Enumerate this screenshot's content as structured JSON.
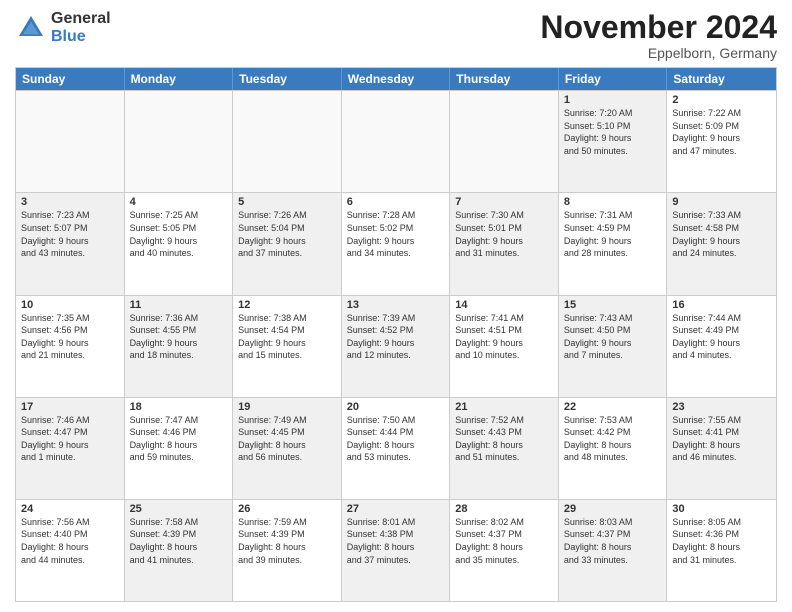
{
  "header": {
    "logo_general": "General",
    "logo_blue": "Blue",
    "month_title": "November 2024",
    "subtitle": "Eppelborn, Germany"
  },
  "calendar": {
    "days_of_week": [
      "Sunday",
      "Monday",
      "Tuesday",
      "Wednesday",
      "Thursday",
      "Friday",
      "Saturday"
    ],
    "rows": [
      [
        {
          "day": "",
          "info": "",
          "empty": true
        },
        {
          "day": "",
          "info": "",
          "empty": true
        },
        {
          "day": "",
          "info": "",
          "empty": true
        },
        {
          "day": "",
          "info": "",
          "empty": true
        },
        {
          "day": "",
          "info": "",
          "empty": true
        },
        {
          "day": "1",
          "info": "Sunrise: 7:20 AM\nSunset: 5:10 PM\nDaylight: 9 hours\nand 50 minutes.",
          "empty": false,
          "shaded": true
        },
        {
          "day": "2",
          "info": "Sunrise: 7:22 AM\nSunset: 5:09 PM\nDaylight: 9 hours\nand 47 minutes.",
          "empty": false,
          "shaded": false
        }
      ],
      [
        {
          "day": "3",
          "info": "Sunrise: 7:23 AM\nSunset: 5:07 PM\nDaylight: 9 hours\nand 43 minutes.",
          "empty": false,
          "shaded": true
        },
        {
          "day": "4",
          "info": "Sunrise: 7:25 AM\nSunset: 5:05 PM\nDaylight: 9 hours\nand 40 minutes.",
          "empty": false,
          "shaded": false
        },
        {
          "day": "5",
          "info": "Sunrise: 7:26 AM\nSunset: 5:04 PM\nDaylight: 9 hours\nand 37 minutes.",
          "empty": false,
          "shaded": true
        },
        {
          "day": "6",
          "info": "Sunrise: 7:28 AM\nSunset: 5:02 PM\nDaylight: 9 hours\nand 34 minutes.",
          "empty": false,
          "shaded": false
        },
        {
          "day": "7",
          "info": "Sunrise: 7:30 AM\nSunset: 5:01 PM\nDaylight: 9 hours\nand 31 minutes.",
          "empty": false,
          "shaded": true
        },
        {
          "day": "8",
          "info": "Sunrise: 7:31 AM\nSunset: 4:59 PM\nDaylight: 9 hours\nand 28 minutes.",
          "empty": false,
          "shaded": false
        },
        {
          "day": "9",
          "info": "Sunrise: 7:33 AM\nSunset: 4:58 PM\nDaylight: 9 hours\nand 24 minutes.",
          "empty": false,
          "shaded": true
        }
      ],
      [
        {
          "day": "10",
          "info": "Sunrise: 7:35 AM\nSunset: 4:56 PM\nDaylight: 9 hours\nand 21 minutes.",
          "empty": false,
          "shaded": false
        },
        {
          "day": "11",
          "info": "Sunrise: 7:36 AM\nSunset: 4:55 PM\nDaylight: 9 hours\nand 18 minutes.",
          "empty": false,
          "shaded": true
        },
        {
          "day": "12",
          "info": "Sunrise: 7:38 AM\nSunset: 4:54 PM\nDaylight: 9 hours\nand 15 minutes.",
          "empty": false,
          "shaded": false
        },
        {
          "day": "13",
          "info": "Sunrise: 7:39 AM\nSunset: 4:52 PM\nDaylight: 9 hours\nand 12 minutes.",
          "empty": false,
          "shaded": true
        },
        {
          "day": "14",
          "info": "Sunrise: 7:41 AM\nSunset: 4:51 PM\nDaylight: 9 hours\nand 10 minutes.",
          "empty": false,
          "shaded": false
        },
        {
          "day": "15",
          "info": "Sunrise: 7:43 AM\nSunset: 4:50 PM\nDaylight: 9 hours\nand 7 minutes.",
          "empty": false,
          "shaded": true
        },
        {
          "day": "16",
          "info": "Sunrise: 7:44 AM\nSunset: 4:49 PM\nDaylight: 9 hours\nand 4 minutes.",
          "empty": false,
          "shaded": false
        }
      ],
      [
        {
          "day": "17",
          "info": "Sunrise: 7:46 AM\nSunset: 4:47 PM\nDaylight: 9 hours\nand 1 minute.",
          "empty": false,
          "shaded": true
        },
        {
          "day": "18",
          "info": "Sunrise: 7:47 AM\nSunset: 4:46 PM\nDaylight: 8 hours\nand 59 minutes.",
          "empty": false,
          "shaded": false
        },
        {
          "day": "19",
          "info": "Sunrise: 7:49 AM\nSunset: 4:45 PM\nDaylight: 8 hours\nand 56 minutes.",
          "empty": false,
          "shaded": true
        },
        {
          "day": "20",
          "info": "Sunrise: 7:50 AM\nSunset: 4:44 PM\nDaylight: 8 hours\nand 53 minutes.",
          "empty": false,
          "shaded": false
        },
        {
          "day": "21",
          "info": "Sunrise: 7:52 AM\nSunset: 4:43 PM\nDaylight: 8 hours\nand 51 minutes.",
          "empty": false,
          "shaded": true
        },
        {
          "day": "22",
          "info": "Sunrise: 7:53 AM\nSunset: 4:42 PM\nDaylight: 8 hours\nand 48 minutes.",
          "empty": false,
          "shaded": false
        },
        {
          "day": "23",
          "info": "Sunrise: 7:55 AM\nSunset: 4:41 PM\nDaylight: 8 hours\nand 46 minutes.",
          "empty": false,
          "shaded": true
        }
      ],
      [
        {
          "day": "24",
          "info": "Sunrise: 7:56 AM\nSunset: 4:40 PM\nDaylight: 8 hours\nand 44 minutes.",
          "empty": false,
          "shaded": false
        },
        {
          "day": "25",
          "info": "Sunrise: 7:58 AM\nSunset: 4:39 PM\nDaylight: 8 hours\nand 41 minutes.",
          "empty": false,
          "shaded": true
        },
        {
          "day": "26",
          "info": "Sunrise: 7:59 AM\nSunset: 4:39 PM\nDaylight: 8 hours\nand 39 minutes.",
          "empty": false,
          "shaded": false
        },
        {
          "day": "27",
          "info": "Sunrise: 8:01 AM\nSunset: 4:38 PM\nDaylight: 8 hours\nand 37 minutes.",
          "empty": false,
          "shaded": true
        },
        {
          "day": "28",
          "info": "Sunrise: 8:02 AM\nSunset: 4:37 PM\nDaylight: 8 hours\nand 35 minutes.",
          "empty": false,
          "shaded": false
        },
        {
          "day": "29",
          "info": "Sunrise: 8:03 AM\nSunset: 4:37 PM\nDaylight: 8 hours\nand 33 minutes.",
          "empty": false,
          "shaded": true
        },
        {
          "day": "30",
          "info": "Sunrise: 8:05 AM\nSunset: 4:36 PM\nDaylight: 8 hours\nand 31 minutes.",
          "empty": false,
          "shaded": false
        }
      ]
    ]
  }
}
